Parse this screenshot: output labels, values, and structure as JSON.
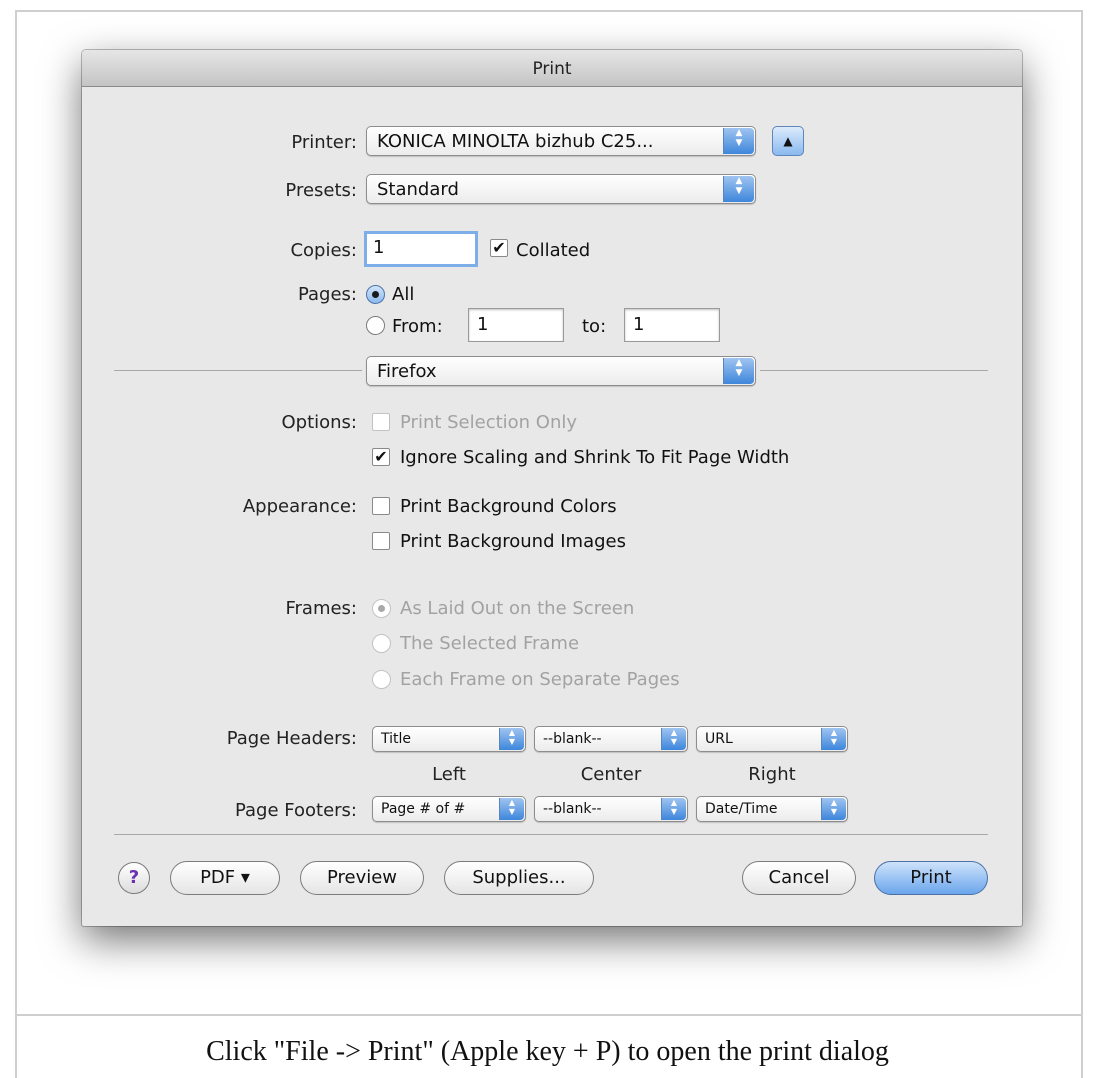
{
  "dialog": {
    "title": "Print",
    "printer_label": "Printer:",
    "printer_value": "KONICA MINOLTA bizhub C25...",
    "presets_label": "Presets:",
    "presets_value": "Standard",
    "copies_label": "Copies:",
    "copies_value": "1",
    "collated_label": "Collated",
    "collated_checked": true,
    "pages_label": "Pages:",
    "pages_all_label": "All",
    "pages_from_label": "From:",
    "pages_from_value": "1",
    "pages_to_label": "to:",
    "pages_to_value": "1",
    "selected_pages_option": "All",
    "section_popup_value": "Firefox",
    "options_label": "Options:",
    "print_selection_only_label": "Print Selection Only",
    "print_selection_only_enabled": false,
    "ignore_scaling_label": "Ignore Scaling and Shrink To Fit Page Width",
    "ignore_scaling_checked": true,
    "appearance_label": "Appearance:",
    "bg_colors_label": "Print Background Colors",
    "bg_colors_checked": false,
    "bg_images_label": "Print Background Images",
    "bg_images_checked": false,
    "frames_label": "Frames:",
    "frames_options": [
      "As Laid Out on the Screen",
      "The Selected Frame",
      "Each Frame on Separate Pages"
    ],
    "frames_selected": "As Laid Out on the Screen",
    "frames_enabled": false,
    "page_headers_label": "Page Headers:",
    "headers": {
      "left": "Title",
      "center": "--blank--",
      "right": "URL"
    },
    "column_labels": {
      "left": "Left",
      "center": "Center",
      "right": "Right"
    },
    "page_footers_label": "Page Footers:",
    "footers": {
      "left": "Page # of #",
      "center": "--blank--",
      "right": "Date/Time"
    },
    "buttons": {
      "help": "?",
      "pdf": "PDF ▾",
      "preview": "Preview",
      "supplies": "Supplies...",
      "cancel": "Cancel",
      "print": "Print"
    },
    "disclosure_glyph": "▲",
    "checkmark_glyph": "✔",
    "popup_arrow_up": "▲",
    "popup_arrow_down": "▼"
  },
  "caption": "Click \"File -> Print\" (Apple key + P) to open the print dialog",
  "colors": {
    "accent_blue": "#3e86dc",
    "dialog_bg": "#e8e8e8",
    "help_purple": "#6b2fb2"
  }
}
